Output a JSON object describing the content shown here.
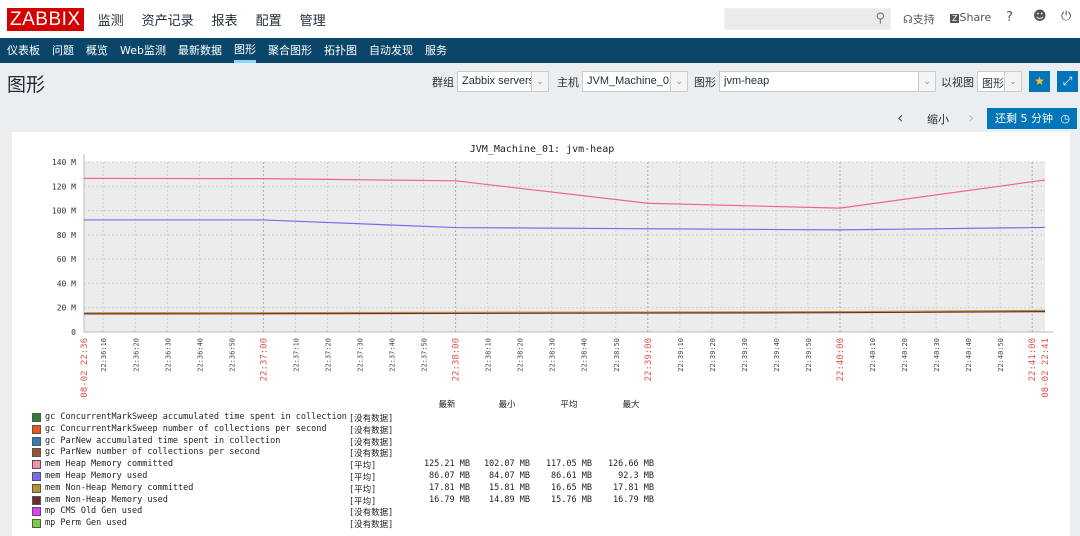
{
  "header": {
    "logo": "ZABBIX",
    "menu": [
      "监测",
      "资产记录",
      "报表",
      "配置",
      "管理"
    ],
    "support": "支持",
    "share": "Share",
    "help": "?"
  },
  "subnav": [
    "仪表板",
    "问题",
    "概览",
    "Web监测",
    "最新数据",
    "图形",
    "聚合图形",
    "拓扑图",
    "自动发现",
    "服务"
  ],
  "page": {
    "title": "图形",
    "group_label": "群组",
    "group_value": "Zabbix servers",
    "host_label": "主机",
    "host_value": "JVM_Machine_01",
    "graph_label": "图形",
    "graph_value": "jvm-heap",
    "view_label": "以视图",
    "view_value": "图形",
    "zoom_out": "缩小",
    "time_button": "还剩 5 分钟"
  },
  "chart_data": {
    "type": "line",
    "title": "JVM_Machine_01: jvm-heap",
    "y_ticks": [
      "0",
      "20 M",
      "40 M",
      "60 M",
      "80 M",
      "100 M",
      "120 M",
      "140 M"
    ],
    "ylim": [
      0,
      140
    ],
    "grid": true,
    "x_start_label": "08-02 22:36",
    "x_end_label": "08-02 22:41",
    "x_minor_ticks": [
      "22:36:10",
      "22:36:20",
      "22:36:30",
      "22:36:40",
      "22:36:50",
      "22:37:00",
      "22:37:10",
      "22:37:20",
      "22:37:30",
      "22:37:40",
      "22:37:50",
      "22:38:00",
      "22:38:10",
      "22:38:20",
      "22:38:30",
      "22:38:40",
      "22:38:50",
      "22:39:00",
      "22:39:10",
      "22:39:20",
      "22:39:30",
      "22:39:40",
      "22:39:50",
      "22:40:00",
      "22:40:10",
      "22:40:20",
      "22:40:30",
      "22:40:40",
      "22:40:50",
      "22:41:00"
    ],
    "x": [
      "22:36:04",
      "22:37:00",
      "22:38:00",
      "22:39:00",
      "22:40:00",
      "22:41:04"
    ],
    "series": [
      {
        "name": "mem Heap Memory committed",
        "color": "#f06292",
        "values": [
          126.5,
          126.3,
          124.5,
          106,
          102,
          125.2
        ]
      },
      {
        "name": "mem Heap Memory used",
        "color": "#7b68ee",
        "values": [
          92.3,
          92.3,
          86,
          85,
          84.1,
          86.1
        ]
      },
      {
        "name": "mem Non-Heap Memory committed",
        "color": "#b8962e",
        "values": [
          15.8,
          15.9,
          16.2,
          16.4,
          16.8,
          17.8
        ]
      },
      {
        "name": "mem Non-Heap Memory used",
        "color": "#6b2b35",
        "values": [
          14.9,
          15,
          15.3,
          15.6,
          15.9,
          16.8
        ]
      }
    ],
    "legend_headers": [
      "最新",
      "最小",
      "平均",
      "最大"
    ],
    "legend": [
      {
        "name": "gc ConcurrentMarkSweep accumulated time spent in collection",
        "color": "#2e7d32",
        "func": "[没有数据]",
        "vals": []
      },
      {
        "name": "gc ConcurrentMarkSweep number of collections per second",
        "color": "#f4511e",
        "func": "[没有数据]",
        "vals": []
      },
      {
        "name": "gc ParNew accumulated time spent in collection",
        "color": "#2f7fb5",
        "func": "[没有数据]",
        "vals": []
      },
      {
        "name": "gc ParNew number of collections per second",
        "color": "#a0522d",
        "func": "[没有数据]",
        "vals": []
      },
      {
        "name": "mem Heap Memory committed",
        "color": "#f48fb1",
        "func": "[平均]",
        "vals": [
          "125.21 MB",
          "102.07 MB",
          "117.05 MB",
          "126.66 MB"
        ]
      },
      {
        "name": "mem Heap Memory used",
        "color": "#7b68ee",
        "func": "[平均]",
        "vals": [
          "86.07 MB",
          "84.07 MB",
          "86.61 MB",
          "92.3 MB"
        ]
      },
      {
        "name": "mem Non-Heap Memory committed",
        "color": "#b8962e",
        "func": "[平均]",
        "vals": [
          "17.81 MB",
          "15.81 MB",
          "16.65 MB",
          "17.81 MB"
        ]
      },
      {
        "name": "mem Non-Heap Memory used",
        "color": "#6b2b35",
        "func": "[平均]",
        "vals": [
          "16.79 MB",
          "14.89 MB",
          "15.76 MB",
          "16.79 MB"
        ]
      },
      {
        "name": "mp CMS Old Gen used",
        "color": "#e040fb",
        "func": "[没有数据]",
        "vals": []
      },
      {
        "name": "mp Perm Gen used",
        "color": "#76d03c",
        "func": "[没有数据]",
        "vals": []
      }
    ]
  }
}
